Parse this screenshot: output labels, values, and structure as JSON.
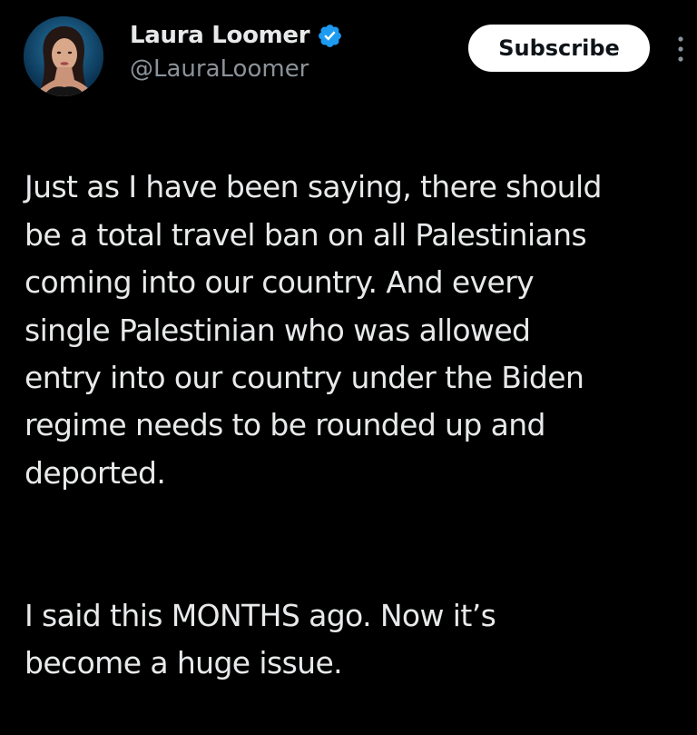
{
  "post": {
    "author": {
      "display_name": "Laura Loomer",
      "handle": "@LauraLoomer",
      "verified_icon": "verified-badge-icon",
      "verified_color": "#1d9bf0"
    },
    "subscribe_label": "Subscribe",
    "more_icon": "more-vertical-icon",
    "paragraphs": [
      "Just as I have been saying, there should\nbe a total travel ban on all Palestinians\ncoming into our country. And every\nsingle Palestinian who was allowed\nentry into our country under the Biden\nregime needs to be rounded up and\ndeported.",
      "I said this MONTHS ago. Now it’s\nbecome a huge issue."
    ]
  },
  "colors": {
    "background": "#000000",
    "text_primary": "#e7e9ea",
    "text_secondary": "#8b9299",
    "button_bg": "#ffffff",
    "button_text": "#0f1419"
  }
}
